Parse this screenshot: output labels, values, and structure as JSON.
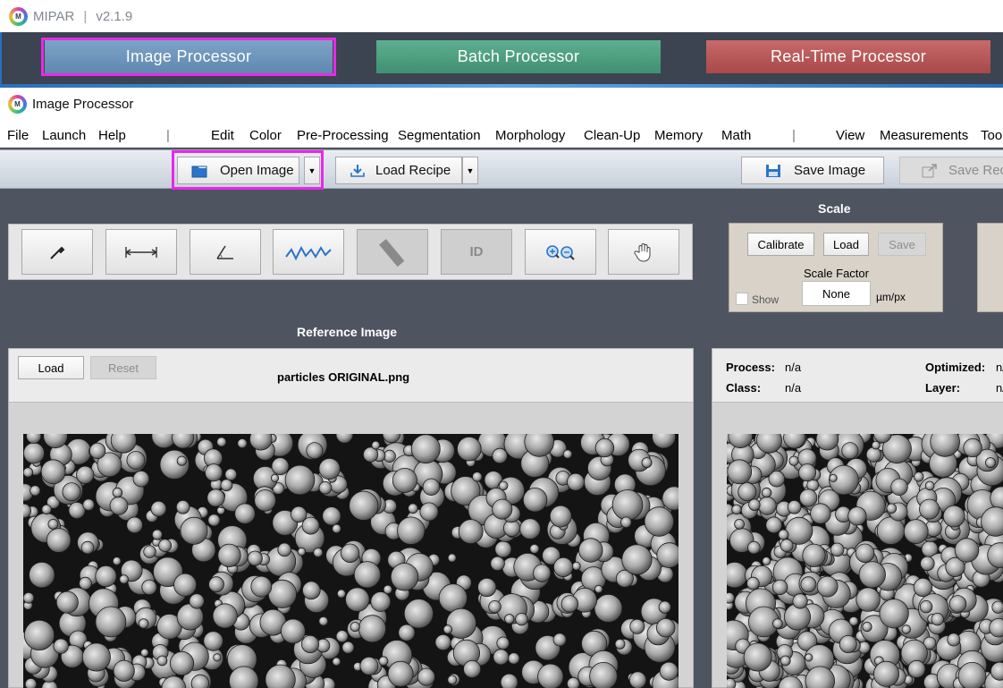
{
  "launcher": {
    "app_name": "MIPAR",
    "separator": "|",
    "version": "v2.1.9",
    "modes": {
      "image": "Image Processor",
      "batch": "Batch Processor",
      "realtime": "Real-Time Processor"
    }
  },
  "window": {
    "title": "Image Processor",
    "logo_letter": "M"
  },
  "menu": {
    "file": "File",
    "launch": "Launch",
    "help": "Help",
    "sep": "|",
    "edit": "Edit",
    "color": "Color",
    "preprocessing": "Pre-Processing",
    "segmentation": "Segmentation",
    "morphology": "Morphology",
    "cleanup": "Clean-Up",
    "memory": "Memory",
    "math": "Math",
    "view": "View",
    "measurements": "Measurements",
    "tools": "Too"
  },
  "toolbar": {
    "open_image": "Open Image",
    "load_recipe": "Load Recipe",
    "save_image": "Save Image",
    "save_recipe": "Save Rec"
  },
  "tools": {
    "id_label": "ID"
  },
  "scale": {
    "title": "Scale",
    "calibrate": "Calibrate",
    "load": "Load",
    "save": "Save",
    "factor_label": "Scale Factor",
    "factor_value": "None",
    "unit": "µm/px",
    "show_label": "Show"
  },
  "reference": {
    "title": "Reference Image",
    "load": "Load",
    "reset": "Reset",
    "filename": "particles ORIGINAL.png"
  },
  "result": {
    "process_label": "Process:",
    "process_value": "n/a",
    "class_label": "Class:",
    "class_value": "n/a",
    "optimized_label": "Optimized:",
    "optimized_value": "n/a",
    "layer_label": "Layer:",
    "layer_value": "n/a"
  },
  "colors": {
    "highlight": "#ea28ea",
    "image_processor": "#6b93b9",
    "batch_processor": "#4c9d7f",
    "realtime_processor": "#b65656"
  }
}
